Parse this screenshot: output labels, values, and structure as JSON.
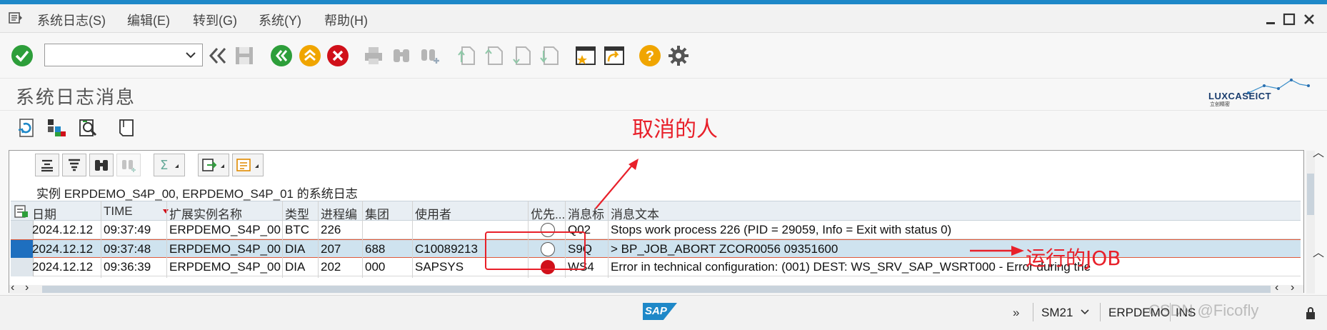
{
  "menu": {
    "items": [
      "系统日志(S)",
      "编辑(E)",
      "转到(G)",
      "系统(Y)",
      "帮助(H)"
    ]
  },
  "toolbar": {
    "command_field_value": "",
    "icons": [
      "enter-icon",
      "back-double-arrow-icon",
      "save-icon",
      "back-green-icon",
      "exit-yellow-icon",
      "cancel-red-icon",
      "print-icon",
      "find-icon",
      "find-next-icon",
      "first-page-icon",
      "prev-page-icon",
      "next-page-icon",
      "last-page-icon",
      "create-session-icon",
      "shortcut-icon",
      "help-icon",
      "settings-icon"
    ]
  },
  "page": {
    "title": "系统日志消息",
    "logo_text": "LUXCASEICT",
    "logo_sub": "立创精密"
  },
  "list": {
    "title": "实例 ERPDEMO_S4P_00, ERPDEMO_S4P_01 的系统日志",
    "columns": [
      "日期",
      "TIME",
      "扩展实例名称",
      "类型",
      "进程编",
      "集团",
      "使用者",
      "优先...",
      "消息标",
      "消息文本"
    ],
    "rows": [
      {
        "date": "2024.12.12",
        "time": "09:37:49",
        "instance": "ERPDEMO_S4P_00",
        "type": "BTC",
        "process": "226",
        "client": "",
        "user": "",
        "priority": "empty",
        "msg_id": "Q02",
        "text": "Stops work process 226 (PID = 29059, Info = Exit with status 0)"
      },
      {
        "date": "2024.12.12",
        "time": "09:37:48",
        "instance": "ERPDEMO_S4P_00",
        "type": "DIA",
        "process": "207",
        "client": "688",
        "user": "C10089213",
        "priority": "empty",
        "msg_id": "S9Q",
        "text": "> BP_JOB_ABORT ZCOR0056 09351600"
      },
      {
        "date": "2024.12.12",
        "time": "09:36:39",
        "instance": "ERPDEMO_S4P_00",
        "type": "DIA",
        "process": "202",
        "client": "000",
        "user": "SAPSYS",
        "priority": "red",
        "msg_id": "WS4",
        "text": "Error in technical configuration: (001) DEST: WS_SRV_SAP_WSRT000 - Error during the"
      }
    ]
  },
  "annotations": {
    "canceller": "取消的人",
    "running_job": "运行的JOB"
  },
  "status": {
    "sap_logo": "SAP",
    "transaction": "SM21",
    "system": "ERPDEMO",
    "mode": "INS",
    "watermark": "CSDN @Ficofly"
  },
  "colors": {
    "accent": "#1e88c8",
    "annotation_red": "#e8202a",
    "selected_row": "#cfe3ef"
  }
}
